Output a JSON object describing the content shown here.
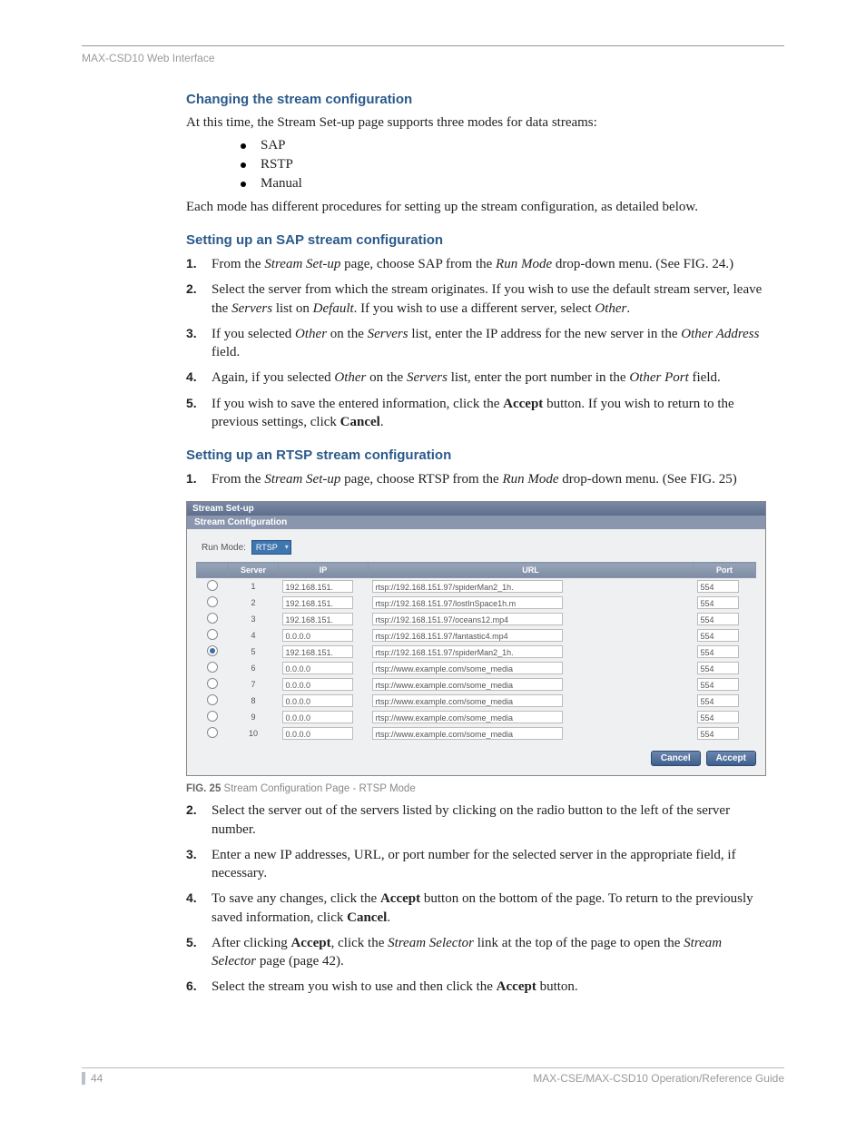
{
  "header": {
    "label": "MAX-CSD10 Web Interface"
  },
  "section1": {
    "title": "Changing the stream configuration",
    "intro": "At this time, the Stream Set-up page supports three modes for data streams:",
    "bullets": [
      "SAP",
      "RSTP",
      "Manual"
    ],
    "outro": "Each mode has different procedures for setting up the stream configuration, as detailed below."
  },
  "section2": {
    "title": "Setting up an SAP stream configuration",
    "steps_html": [
      "From the <em>Stream Set-up</em> page, choose SAP from the <em>Run Mode</em> drop-down menu. (See FIG. 24.)",
      "Select the server from which the stream originates. If you wish to use the default stream server, leave the <em>Servers</em> list on <em>Default</em>. If you wish to use a different server, select <em>Other</em>.",
      "If you selected <em>Other</em> on the <em>Servers</em> list, enter the IP address for the new server in the <em>Other Address</em> field.",
      "Again, if you selected <em>Other</em> on the <em>Servers</em> list, enter the port number in the <em>Other Port</em> field.",
      "If you wish to save the entered information, click the <b>Accept</b> button. If you wish to return to the previous settings, click <b>Cancel</b>."
    ]
  },
  "section3": {
    "title": "Setting up an RTSP stream configuration",
    "step1_html": "From the <em>Stream Set-up</em> page, choose RTSP from the <em>Run Mode</em> drop-down menu. (See FIG. 25)"
  },
  "figure": {
    "panel_title": "Stream Set-up",
    "panel_sub": "Stream Configuration",
    "runmode_label": "Run Mode:",
    "runmode_value": "RTSP",
    "headers": [
      "",
      "Server",
      "IP",
      "URL",
      "Port"
    ],
    "selected_row": 5,
    "rows": [
      {
        "server": "1",
        "ip": "192.168.151.",
        "url": "rtsp://192.168.151.97/spiderMan2_1h.",
        "port": "554"
      },
      {
        "server": "2",
        "ip": "192.168.151.",
        "url": "rtsp://192.168.151.97/lostInSpace1h.m",
        "port": "554"
      },
      {
        "server": "3",
        "ip": "192.168.151.",
        "url": "rtsp://192.168.151.97/oceans12.mp4",
        "port": "554"
      },
      {
        "server": "4",
        "ip": "0.0.0.0",
        "url": "rtsp://192.168.151.97/fantastic4.mp4",
        "port": "554"
      },
      {
        "server": "5",
        "ip": "192.168.151.",
        "url": "rtsp://192.168.151.97/spiderMan2_1h.",
        "port": "554"
      },
      {
        "server": "6",
        "ip": "0.0.0.0",
        "url": "rtsp://www.example.com/some_media",
        "port": "554"
      },
      {
        "server": "7",
        "ip": "0.0.0.0",
        "url": "rtsp://www.example.com/some_media",
        "port": "554"
      },
      {
        "server": "8",
        "ip": "0.0.0.0",
        "url": "rtsp://www.example.com/some_media",
        "port": "554"
      },
      {
        "server": "9",
        "ip": "0.0.0.0",
        "url": "rtsp://www.example.com/some_media",
        "port": "554"
      },
      {
        "server": "10",
        "ip": "0.0.0.0",
        "url": "rtsp://www.example.com/some_media",
        "port": "554"
      }
    ],
    "btn_cancel": "Cancel",
    "btn_accept": "Accept",
    "caption_label": "FIG. 25",
    "caption_text": " Stream Configuration Page - RTSP Mode"
  },
  "section3b_steps_html": [
    "Select the server out of the servers listed by clicking on the radio button to the left of the server number.",
    "Enter a new IP addresses, URL, or port number for the selected server in the appropriate field, if necessary.",
    "To save any changes, click the <b>Accept</b> button on the bottom of the page. To return to the previously saved information, click <b>Cancel</b>.",
    "After clicking <b>Accept</b>, click the <em>Stream Selector</em> link at the top of the page to open the <em>Stream Selector</em> page (page 42).",
    "Select the stream you wish to use and then click the <b>Accept</b> button."
  ],
  "footer": {
    "page": "44",
    "guide": "MAX-CSE/MAX-CSD10 Operation/Reference Guide"
  }
}
